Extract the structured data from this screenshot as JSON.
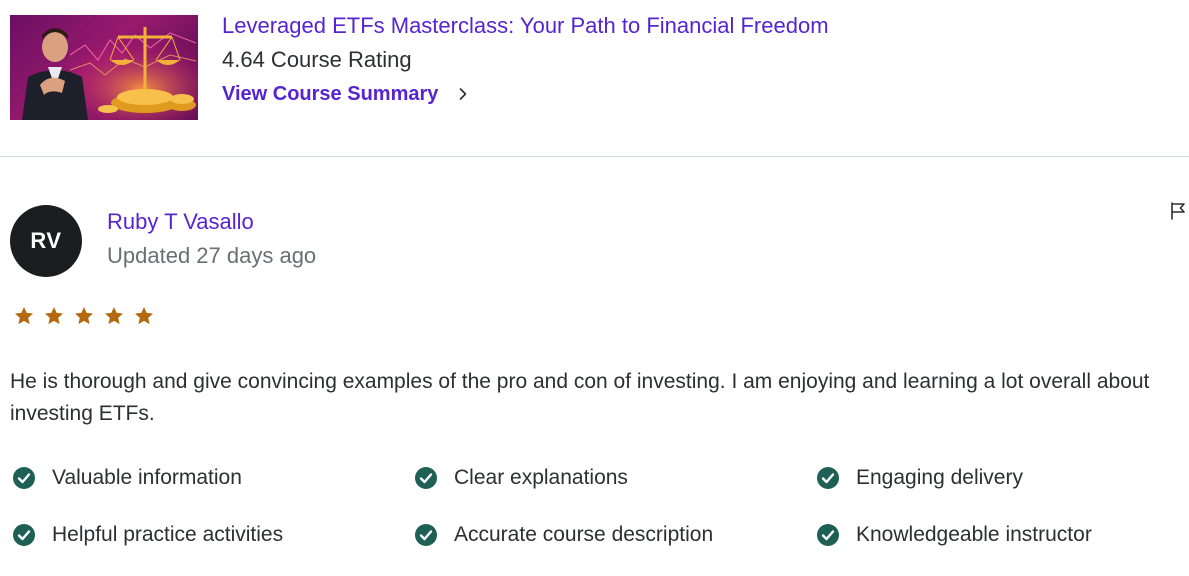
{
  "course": {
    "title": "Leveraged ETFs Masterclass: Your Path to Financial Freedom",
    "rating_text": "4.64 Course Rating",
    "summary_link": "View Course Summary",
    "thumbnail_icon": "course-thumbnail-image"
  },
  "review": {
    "avatar_initials": "RV",
    "reviewer_name": "Ruby T Vasallo",
    "updated_text": "Updated 27 days ago",
    "rating": 5,
    "star_color": "#b4690e",
    "text": "He is thorough and give convincing examples of the pro and con of investing. I am enjoying and learning a lot overall about investing ETFs.",
    "tags": [
      "Valuable information",
      "Clear explanations",
      "Engaging delivery",
      "Helpful practice activities",
      "Accurate course description",
      "Knowledgeable instructor"
    ],
    "check_color": "#1e6055"
  },
  "colors": {
    "link": "#5624d0",
    "muted": "#6a6f73",
    "text": "#2d2f31",
    "avatar_bg": "#1c1d1f",
    "divider": "#d1d7dc"
  }
}
